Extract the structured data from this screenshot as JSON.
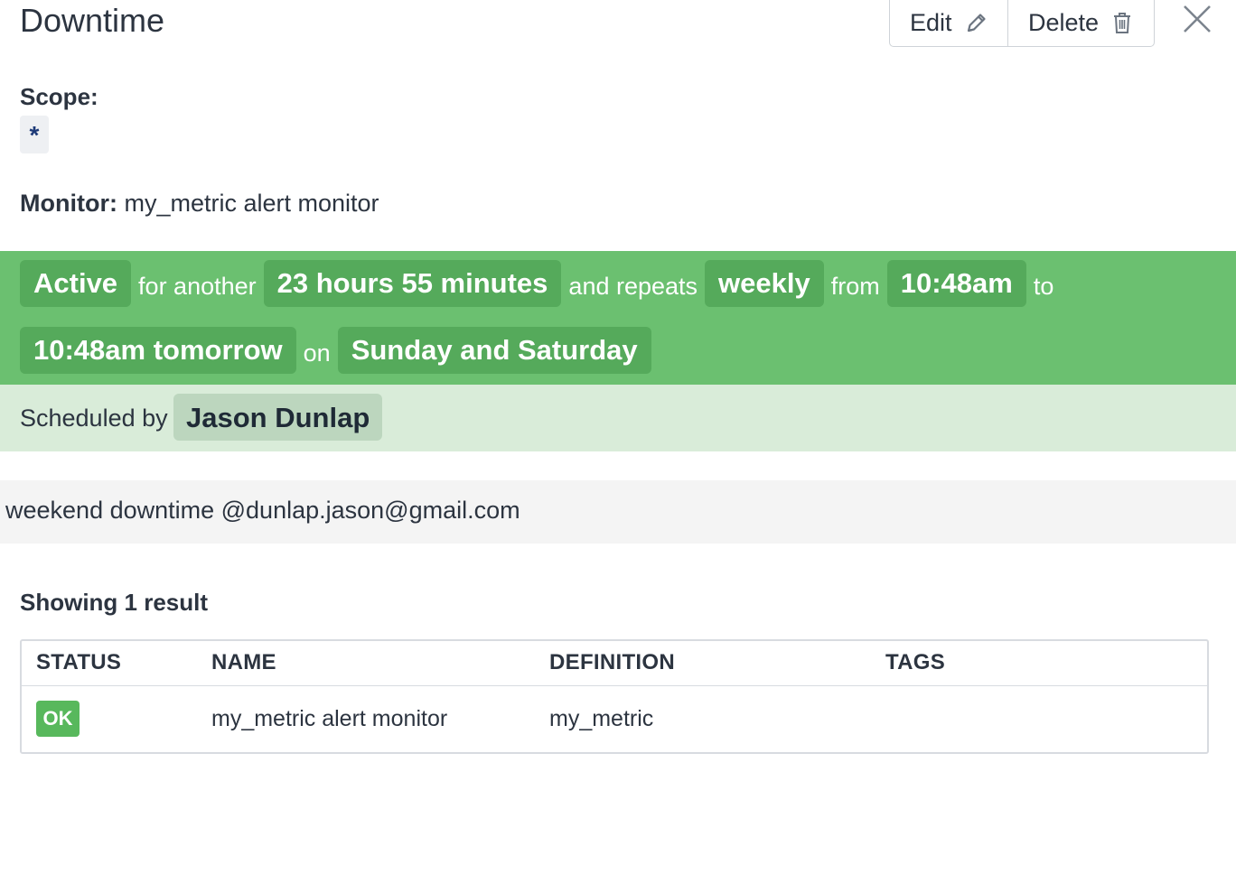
{
  "header": {
    "title": "Downtime",
    "edit_label": "Edit",
    "delete_label": "Delete"
  },
  "scope": {
    "label": "Scope:",
    "value": "*"
  },
  "monitor": {
    "label": "Monitor:",
    "value": "my_metric alert monitor"
  },
  "schedule": {
    "status": "Active",
    "word_for_another": "for another",
    "duration": "23 hours 55 minutes",
    "word_and_repeats": "and repeats",
    "recurrence": "weekly",
    "word_from": "from",
    "start_time": "10:48am",
    "word_to": "to",
    "end_time": "10:48am tomorrow",
    "word_on": "on",
    "days": "Sunday and Saturday",
    "scheduled_by_label": "Scheduled by",
    "scheduled_by": "Jason Dunlap"
  },
  "message": "weekend downtime @dunlap.jason@gmail.com",
  "results": {
    "summary": "Showing 1 result",
    "columns": [
      "STATUS",
      "NAME",
      "DEFINITION",
      "TAGS"
    ],
    "rows": [
      {
        "status": "OK",
        "name": "my_metric alert monitor",
        "definition": "my_metric",
        "tags": ""
      }
    ]
  },
  "colors": {
    "active_band": "#6bc070",
    "active_pill": "#55aa5b",
    "scheduled_band": "#d9ecd9",
    "ok_badge": "#58b85c"
  },
  "icons": [
    "pencil-icon",
    "trash-icon",
    "close-icon"
  ]
}
